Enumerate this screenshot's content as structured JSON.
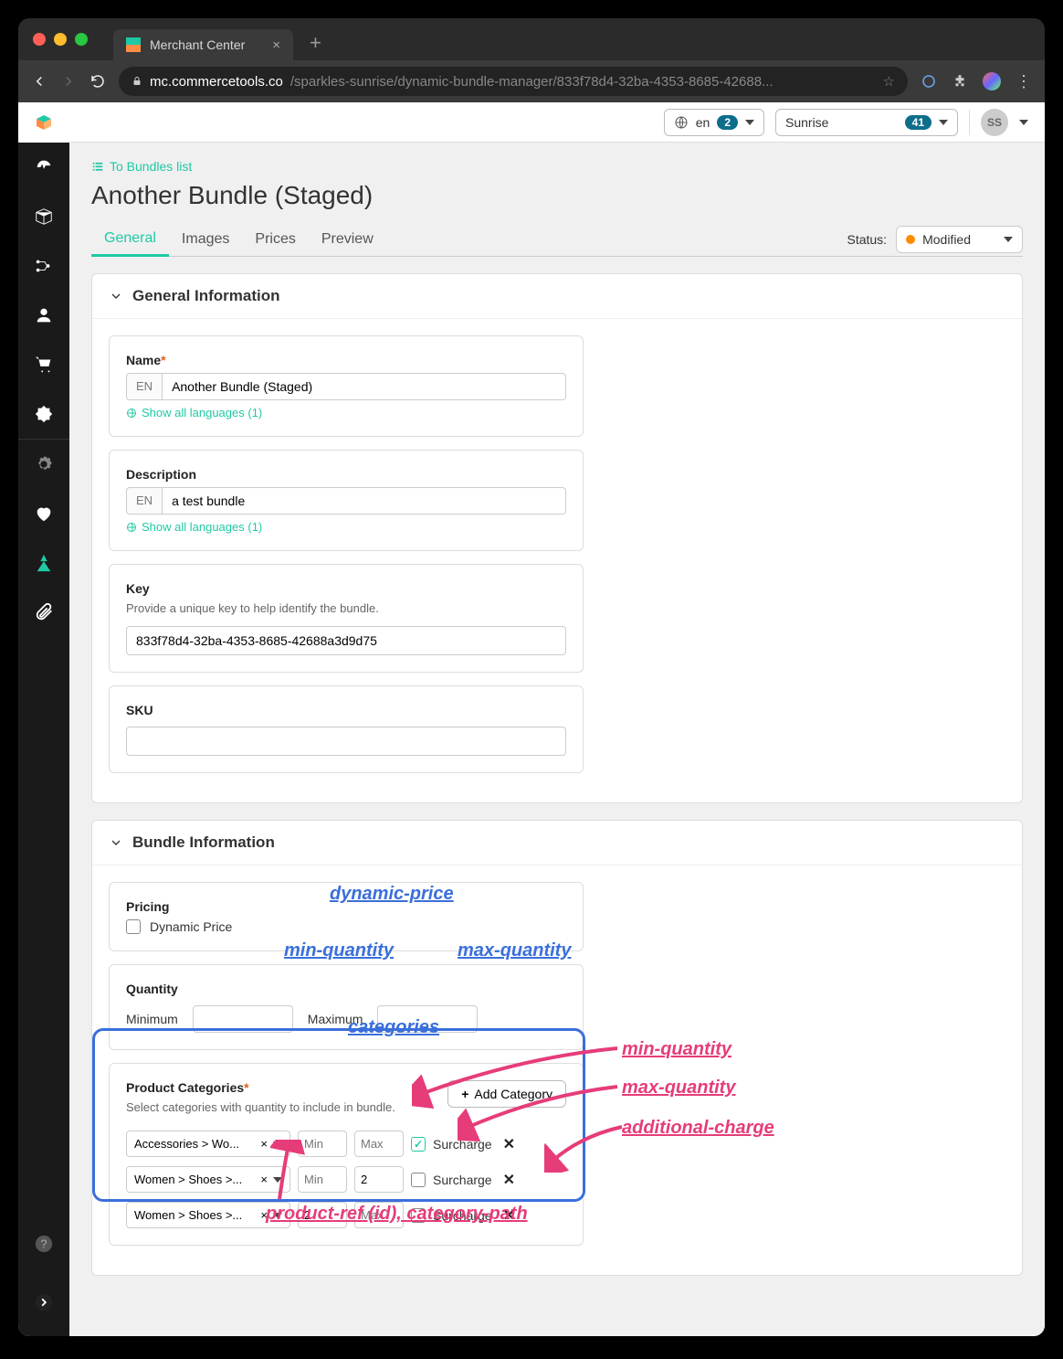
{
  "browser": {
    "tab_title": "Merchant Center",
    "url_domain": "mc.commercetools.co",
    "url_path": "/sparkles-sunrise/dynamic-bundle-manager/833f78d4-32ba-4353-8685-42688..."
  },
  "topbar": {
    "lang": "en",
    "lang_badge": "2",
    "project": "Sunrise",
    "project_badge": "41",
    "avatar": "SS"
  },
  "crumb": "To Bundles list",
  "title": "Another Bundle (Staged)",
  "tabs": {
    "general": "General",
    "images": "Images",
    "prices": "Prices",
    "preview": "Preview"
  },
  "status_label": "Status:",
  "status_value": "Modified",
  "sections": {
    "general_info": "General Information",
    "bundle_info": "Bundle Information"
  },
  "name": {
    "label": "Name",
    "locale": "EN",
    "value": "Another Bundle (Staged)",
    "langs_link": "Show all languages (1)"
  },
  "desc": {
    "label": "Description",
    "locale": "EN",
    "value": "a test bundle",
    "langs_link": "Show all languages (1)"
  },
  "key": {
    "label": "Key",
    "hint": "Provide a unique key to help identify the bundle.",
    "value": "833f78d4-32ba-4353-8685-42688a3d9d75"
  },
  "sku": {
    "label": "SKU",
    "value": ""
  },
  "pricing": {
    "label": "Pricing",
    "dynamic_label": "Dynamic Price",
    "dynamic_checked": false
  },
  "quantity": {
    "label": "Quantity",
    "min_label": "Minimum",
    "max_label": "Maximum",
    "min": "",
    "max": ""
  },
  "categories": {
    "label": "Product Categories",
    "hint": "Select categories with quantity to include in bundle.",
    "add_label": "Add Category",
    "min_ph": "Min",
    "max_ph": "Max",
    "surcharge_label": "Surcharge",
    "rows": [
      {
        "path": "Accessories > Wo...",
        "min": "",
        "max": "",
        "surcharge": true
      },
      {
        "path": "Women > Shoes >...",
        "min": "",
        "max": "2",
        "surcharge": false
      },
      {
        "path": "Women > Shoes >...",
        "min": "2",
        "max": "",
        "surcharge": false
      }
    ]
  },
  "annotations": {
    "dynamic_price": "dynamic-price",
    "min_q": "min-quantity",
    "max_q": "max-quantity",
    "categories": "categories",
    "row_min": "min-quantity",
    "row_max": "max-quantity",
    "additional_charge": "additional-charge",
    "product_ref": "product-ref (id), category-path"
  }
}
